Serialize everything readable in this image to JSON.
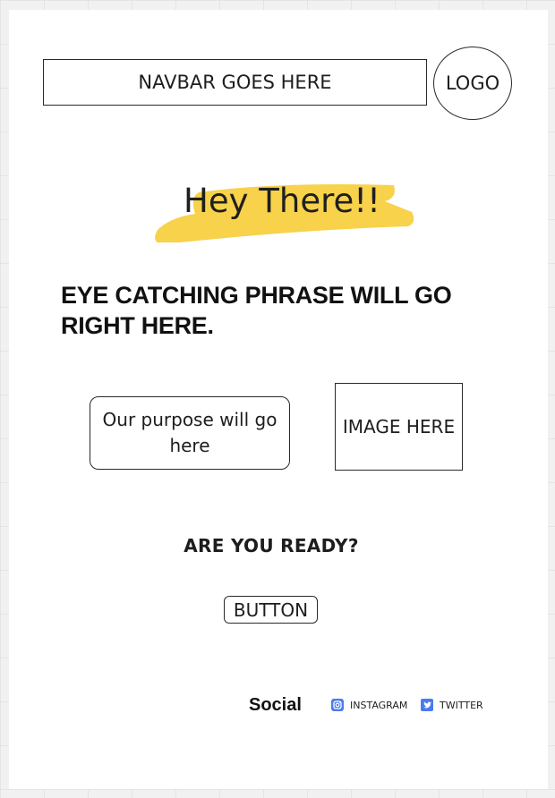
{
  "header": {
    "navbar_label": "NAVBAR GOES HERE",
    "logo_label": "LOGO"
  },
  "hero": {
    "greeting": "Hey There!!",
    "highlight_color": "#f7d24a",
    "phrase": "EYE CATCHING PHRASE WILL GO RIGHT HERE."
  },
  "content": {
    "purpose_text": "Our purpose will go here",
    "image_placeholder": "IMAGE HERE"
  },
  "cta": {
    "question": "ARE YOU READY?",
    "button_label": "BUTTON"
  },
  "footer": {
    "social_label": "Social",
    "links": [
      {
        "label": "INSTAGRAM",
        "icon": "instagram-icon",
        "color": "#4a7cf0"
      },
      {
        "label": "TWITTER",
        "icon": "twitter-icon",
        "color": "#4a7cf0"
      }
    ]
  }
}
